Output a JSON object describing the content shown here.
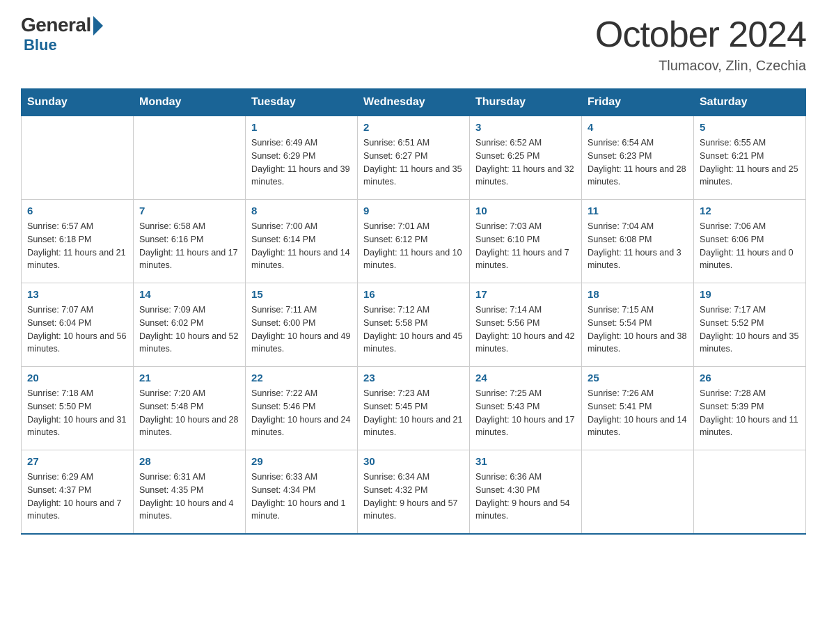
{
  "header": {
    "logo_general": "General",
    "logo_blue": "Blue",
    "month_title": "October 2024",
    "location": "Tlumacov, Zlin, Czechia"
  },
  "days_of_week": [
    "Sunday",
    "Monday",
    "Tuesday",
    "Wednesday",
    "Thursday",
    "Friday",
    "Saturday"
  ],
  "weeks": [
    [
      {
        "day": "",
        "sunrise": "",
        "sunset": "",
        "daylight": ""
      },
      {
        "day": "",
        "sunrise": "",
        "sunset": "",
        "daylight": ""
      },
      {
        "day": "1",
        "sunrise": "Sunrise: 6:49 AM",
        "sunset": "Sunset: 6:29 PM",
        "daylight": "Daylight: 11 hours and 39 minutes."
      },
      {
        "day": "2",
        "sunrise": "Sunrise: 6:51 AM",
        "sunset": "Sunset: 6:27 PM",
        "daylight": "Daylight: 11 hours and 35 minutes."
      },
      {
        "day": "3",
        "sunrise": "Sunrise: 6:52 AM",
        "sunset": "Sunset: 6:25 PM",
        "daylight": "Daylight: 11 hours and 32 minutes."
      },
      {
        "day": "4",
        "sunrise": "Sunrise: 6:54 AM",
        "sunset": "Sunset: 6:23 PM",
        "daylight": "Daylight: 11 hours and 28 minutes."
      },
      {
        "day": "5",
        "sunrise": "Sunrise: 6:55 AM",
        "sunset": "Sunset: 6:21 PM",
        "daylight": "Daylight: 11 hours and 25 minutes."
      }
    ],
    [
      {
        "day": "6",
        "sunrise": "Sunrise: 6:57 AM",
        "sunset": "Sunset: 6:18 PM",
        "daylight": "Daylight: 11 hours and 21 minutes."
      },
      {
        "day": "7",
        "sunrise": "Sunrise: 6:58 AM",
        "sunset": "Sunset: 6:16 PM",
        "daylight": "Daylight: 11 hours and 17 minutes."
      },
      {
        "day": "8",
        "sunrise": "Sunrise: 7:00 AM",
        "sunset": "Sunset: 6:14 PM",
        "daylight": "Daylight: 11 hours and 14 minutes."
      },
      {
        "day": "9",
        "sunrise": "Sunrise: 7:01 AM",
        "sunset": "Sunset: 6:12 PM",
        "daylight": "Daylight: 11 hours and 10 minutes."
      },
      {
        "day": "10",
        "sunrise": "Sunrise: 7:03 AM",
        "sunset": "Sunset: 6:10 PM",
        "daylight": "Daylight: 11 hours and 7 minutes."
      },
      {
        "day": "11",
        "sunrise": "Sunrise: 7:04 AM",
        "sunset": "Sunset: 6:08 PM",
        "daylight": "Daylight: 11 hours and 3 minutes."
      },
      {
        "day": "12",
        "sunrise": "Sunrise: 7:06 AM",
        "sunset": "Sunset: 6:06 PM",
        "daylight": "Daylight: 11 hours and 0 minutes."
      }
    ],
    [
      {
        "day": "13",
        "sunrise": "Sunrise: 7:07 AM",
        "sunset": "Sunset: 6:04 PM",
        "daylight": "Daylight: 10 hours and 56 minutes."
      },
      {
        "day": "14",
        "sunrise": "Sunrise: 7:09 AM",
        "sunset": "Sunset: 6:02 PM",
        "daylight": "Daylight: 10 hours and 52 minutes."
      },
      {
        "day": "15",
        "sunrise": "Sunrise: 7:11 AM",
        "sunset": "Sunset: 6:00 PM",
        "daylight": "Daylight: 10 hours and 49 minutes."
      },
      {
        "day": "16",
        "sunrise": "Sunrise: 7:12 AM",
        "sunset": "Sunset: 5:58 PM",
        "daylight": "Daylight: 10 hours and 45 minutes."
      },
      {
        "day": "17",
        "sunrise": "Sunrise: 7:14 AM",
        "sunset": "Sunset: 5:56 PM",
        "daylight": "Daylight: 10 hours and 42 minutes."
      },
      {
        "day": "18",
        "sunrise": "Sunrise: 7:15 AM",
        "sunset": "Sunset: 5:54 PM",
        "daylight": "Daylight: 10 hours and 38 minutes."
      },
      {
        "day": "19",
        "sunrise": "Sunrise: 7:17 AM",
        "sunset": "Sunset: 5:52 PM",
        "daylight": "Daylight: 10 hours and 35 minutes."
      }
    ],
    [
      {
        "day": "20",
        "sunrise": "Sunrise: 7:18 AM",
        "sunset": "Sunset: 5:50 PM",
        "daylight": "Daylight: 10 hours and 31 minutes."
      },
      {
        "day": "21",
        "sunrise": "Sunrise: 7:20 AM",
        "sunset": "Sunset: 5:48 PM",
        "daylight": "Daylight: 10 hours and 28 minutes."
      },
      {
        "day": "22",
        "sunrise": "Sunrise: 7:22 AM",
        "sunset": "Sunset: 5:46 PM",
        "daylight": "Daylight: 10 hours and 24 minutes."
      },
      {
        "day": "23",
        "sunrise": "Sunrise: 7:23 AM",
        "sunset": "Sunset: 5:45 PM",
        "daylight": "Daylight: 10 hours and 21 minutes."
      },
      {
        "day": "24",
        "sunrise": "Sunrise: 7:25 AM",
        "sunset": "Sunset: 5:43 PM",
        "daylight": "Daylight: 10 hours and 17 minutes."
      },
      {
        "day": "25",
        "sunrise": "Sunrise: 7:26 AM",
        "sunset": "Sunset: 5:41 PM",
        "daylight": "Daylight: 10 hours and 14 minutes."
      },
      {
        "day": "26",
        "sunrise": "Sunrise: 7:28 AM",
        "sunset": "Sunset: 5:39 PM",
        "daylight": "Daylight: 10 hours and 11 minutes."
      }
    ],
    [
      {
        "day": "27",
        "sunrise": "Sunrise: 6:29 AM",
        "sunset": "Sunset: 4:37 PM",
        "daylight": "Daylight: 10 hours and 7 minutes."
      },
      {
        "day": "28",
        "sunrise": "Sunrise: 6:31 AM",
        "sunset": "Sunset: 4:35 PM",
        "daylight": "Daylight: 10 hours and 4 minutes."
      },
      {
        "day": "29",
        "sunrise": "Sunrise: 6:33 AM",
        "sunset": "Sunset: 4:34 PM",
        "daylight": "Daylight: 10 hours and 1 minute."
      },
      {
        "day": "30",
        "sunrise": "Sunrise: 6:34 AM",
        "sunset": "Sunset: 4:32 PM",
        "daylight": "Daylight: 9 hours and 57 minutes."
      },
      {
        "day": "31",
        "sunrise": "Sunrise: 6:36 AM",
        "sunset": "Sunset: 4:30 PM",
        "daylight": "Daylight: 9 hours and 54 minutes."
      },
      {
        "day": "",
        "sunrise": "",
        "sunset": "",
        "daylight": ""
      },
      {
        "day": "",
        "sunrise": "",
        "sunset": "",
        "daylight": ""
      }
    ]
  ]
}
